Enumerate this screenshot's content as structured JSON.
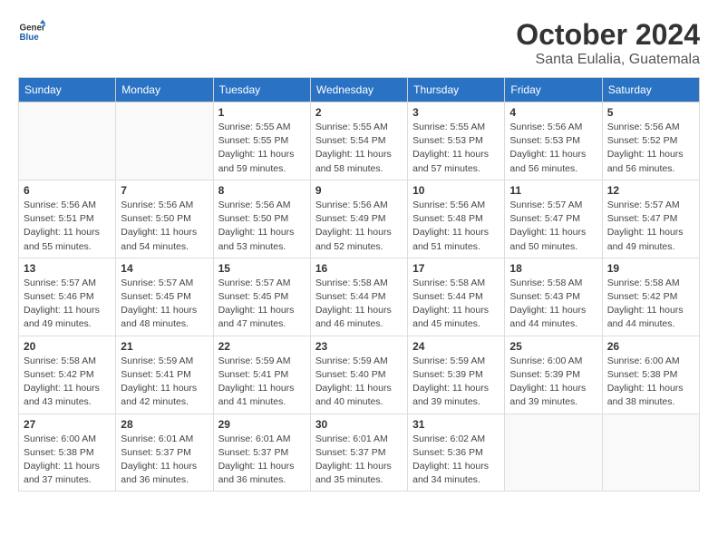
{
  "header": {
    "logo": {
      "general": "General",
      "blue": "Blue"
    },
    "title": "October 2024",
    "location": "Santa Eulalia, Guatemala"
  },
  "days_of_week": [
    "Sunday",
    "Monday",
    "Tuesday",
    "Wednesday",
    "Thursday",
    "Friday",
    "Saturday"
  ],
  "weeks": [
    [
      {
        "day": "",
        "info": ""
      },
      {
        "day": "",
        "info": ""
      },
      {
        "day": "1",
        "info": "Sunrise: 5:55 AM\nSunset: 5:55 PM\nDaylight: 11 hours and 59 minutes."
      },
      {
        "day": "2",
        "info": "Sunrise: 5:55 AM\nSunset: 5:54 PM\nDaylight: 11 hours and 58 minutes."
      },
      {
        "day": "3",
        "info": "Sunrise: 5:55 AM\nSunset: 5:53 PM\nDaylight: 11 hours and 57 minutes."
      },
      {
        "day": "4",
        "info": "Sunrise: 5:56 AM\nSunset: 5:53 PM\nDaylight: 11 hours and 56 minutes."
      },
      {
        "day": "5",
        "info": "Sunrise: 5:56 AM\nSunset: 5:52 PM\nDaylight: 11 hours and 56 minutes."
      }
    ],
    [
      {
        "day": "6",
        "info": "Sunrise: 5:56 AM\nSunset: 5:51 PM\nDaylight: 11 hours and 55 minutes."
      },
      {
        "day": "7",
        "info": "Sunrise: 5:56 AM\nSunset: 5:50 PM\nDaylight: 11 hours and 54 minutes."
      },
      {
        "day": "8",
        "info": "Sunrise: 5:56 AM\nSunset: 5:50 PM\nDaylight: 11 hours and 53 minutes."
      },
      {
        "day": "9",
        "info": "Sunrise: 5:56 AM\nSunset: 5:49 PM\nDaylight: 11 hours and 52 minutes."
      },
      {
        "day": "10",
        "info": "Sunrise: 5:56 AM\nSunset: 5:48 PM\nDaylight: 11 hours and 51 minutes."
      },
      {
        "day": "11",
        "info": "Sunrise: 5:57 AM\nSunset: 5:47 PM\nDaylight: 11 hours and 50 minutes."
      },
      {
        "day": "12",
        "info": "Sunrise: 5:57 AM\nSunset: 5:47 PM\nDaylight: 11 hours and 49 minutes."
      }
    ],
    [
      {
        "day": "13",
        "info": "Sunrise: 5:57 AM\nSunset: 5:46 PM\nDaylight: 11 hours and 49 minutes."
      },
      {
        "day": "14",
        "info": "Sunrise: 5:57 AM\nSunset: 5:45 PM\nDaylight: 11 hours and 48 minutes."
      },
      {
        "day": "15",
        "info": "Sunrise: 5:57 AM\nSunset: 5:45 PM\nDaylight: 11 hours and 47 minutes."
      },
      {
        "day": "16",
        "info": "Sunrise: 5:58 AM\nSunset: 5:44 PM\nDaylight: 11 hours and 46 minutes."
      },
      {
        "day": "17",
        "info": "Sunrise: 5:58 AM\nSunset: 5:44 PM\nDaylight: 11 hours and 45 minutes."
      },
      {
        "day": "18",
        "info": "Sunrise: 5:58 AM\nSunset: 5:43 PM\nDaylight: 11 hours and 44 minutes."
      },
      {
        "day": "19",
        "info": "Sunrise: 5:58 AM\nSunset: 5:42 PM\nDaylight: 11 hours and 44 minutes."
      }
    ],
    [
      {
        "day": "20",
        "info": "Sunrise: 5:58 AM\nSunset: 5:42 PM\nDaylight: 11 hours and 43 minutes."
      },
      {
        "day": "21",
        "info": "Sunrise: 5:59 AM\nSunset: 5:41 PM\nDaylight: 11 hours and 42 minutes."
      },
      {
        "day": "22",
        "info": "Sunrise: 5:59 AM\nSunset: 5:41 PM\nDaylight: 11 hours and 41 minutes."
      },
      {
        "day": "23",
        "info": "Sunrise: 5:59 AM\nSunset: 5:40 PM\nDaylight: 11 hours and 40 minutes."
      },
      {
        "day": "24",
        "info": "Sunrise: 5:59 AM\nSunset: 5:39 PM\nDaylight: 11 hours and 39 minutes."
      },
      {
        "day": "25",
        "info": "Sunrise: 6:00 AM\nSunset: 5:39 PM\nDaylight: 11 hours and 39 minutes."
      },
      {
        "day": "26",
        "info": "Sunrise: 6:00 AM\nSunset: 5:38 PM\nDaylight: 11 hours and 38 minutes."
      }
    ],
    [
      {
        "day": "27",
        "info": "Sunrise: 6:00 AM\nSunset: 5:38 PM\nDaylight: 11 hours and 37 minutes."
      },
      {
        "day": "28",
        "info": "Sunrise: 6:01 AM\nSunset: 5:37 PM\nDaylight: 11 hours and 36 minutes."
      },
      {
        "day": "29",
        "info": "Sunrise: 6:01 AM\nSunset: 5:37 PM\nDaylight: 11 hours and 36 minutes."
      },
      {
        "day": "30",
        "info": "Sunrise: 6:01 AM\nSunset: 5:37 PM\nDaylight: 11 hours and 35 minutes."
      },
      {
        "day": "31",
        "info": "Sunrise: 6:02 AM\nSunset: 5:36 PM\nDaylight: 11 hours and 34 minutes."
      },
      {
        "day": "",
        "info": ""
      },
      {
        "day": "",
        "info": ""
      }
    ]
  ]
}
